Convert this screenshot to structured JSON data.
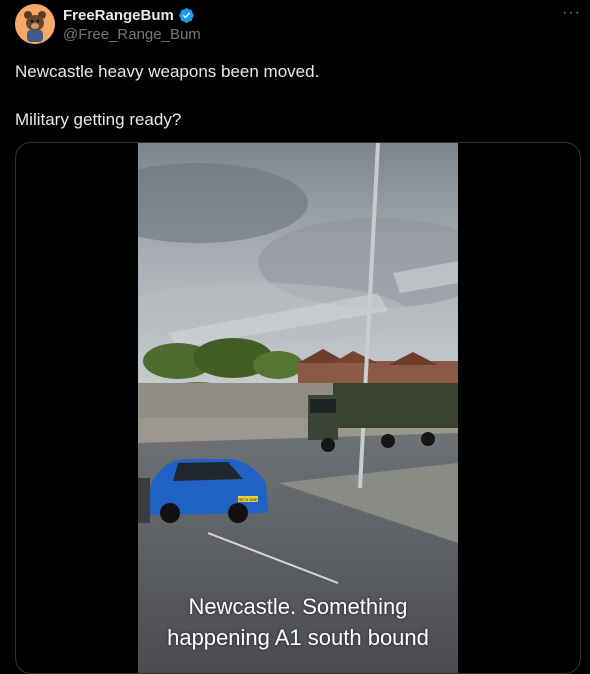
{
  "author": {
    "display_name": "FreeRangeBum",
    "handle": "@Free_Range_Bum",
    "verified": true,
    "avatar_icon": "cartoon-bear-avatar",
    "verified_icon": "verified-badge-icon",
    "verified_color": "#1d9bf0"
  },
  "menu": {
    "more_label": "···"
  },
  "tweet": {
    "paragraphs": [
      "Newcastle heavy weapons been moved.",
      "Military getting ready?"
    ]
  },
  "media": {
    "type": "video",
    "caption_lines": [
      "Newcastle. Something",
      "happening A1 south bound"
    ],
    "plate_text": "RE74 EBE"
  }
}
